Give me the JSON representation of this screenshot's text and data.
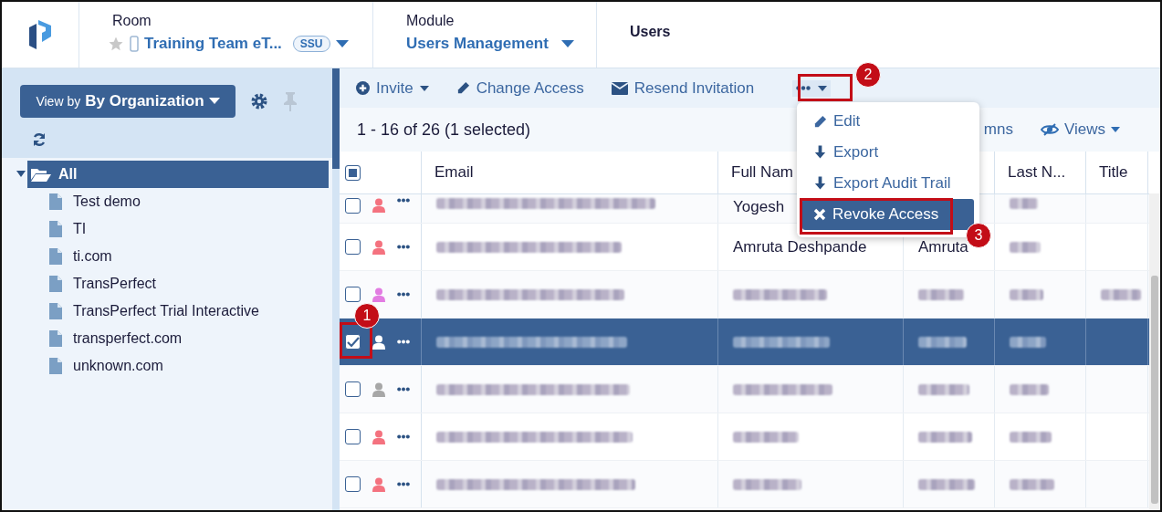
{
  "breadcrumb": {
    "room": {
      "label": "Room",
      "name": "Training Team eT...",
      "badge": "SSU",
      "starred": false
    },
    "module": {
      "label": "Module",
      "name": "Users Management"
    },
    "current": "Users"
  },
  "sidebar": {
    "view_by": {
      "label": "View by",
      "value": "By Organization"
    },
    "tree": [
      {
        "label": "All",
        "selected": true,
        "expanded": true,
        "children": [
          {
            "label": "Test demo",
            "selected": false
          },
          {
            "label": "TI",
            "selected": false
          },
          {
            "label": "ti.com",
            "selected": false
          },
          {
            "label": "TransPerfect",
            "selected": false
          },
          {
            "label": "TransPerfect Trial Interactive",
            "selected": false
          },
          {
            "label": "transperfect.com",
            "selected": false
          },
          {
            "label": "unknown.com",
            "selected": false
          }
        ]
      }
    ]
  },
  "toolbar": {
    "buttons": [
      {
        "label": "Invite",
        "kind": "invite"
      },
      {
        "label": "Change Access",
        "kind": "edit"
      },
      {
        "label": "Resend Invitation",
        "kind": "mail"
      }
    ],
    "more_open": true
  },
  "summary": "1 - 16 of 26 (1 selected)",
  "columns_button": "mns",
  "views_button": "Views",
  "more_menu": [
    {
      "label": "Edit",
      "kind": "edit",
      "selected": false
    },
    {
      "label": "Export",
      "kind": "download",
      "selected": false
    },
    {
      "label": "Export Audit Trail",
      "kind": "download",
      "selected": false
    },
    {
      "label": "Revoke Access",
      "kind": "revoke",
      "selected": true
    }
  ],
  "table": {
    "select_all_partial": true,
    "columns": [
      "Email",
      "Full Nam",
      "",
      "Last N...",
      "Title"
    ],
    "rows": [
      {
        "checked": false,
        "selected": false,
        "color": "#f4727f",
        "cells": [
          {
            "kind": "redacted"
          },
          {
            "kind": "text",
            "text": "Yogesh"
          },
          {
            "kind": "empty"
          },
          {
            "kind": "redacted"
          },
          {
            "kind": "empty"
          }
        ]
      },
      {
        "checked": false,
        "selected": false,
        "color": "#f4727f",
        "cells": [
          {
            "kind": "redacted"
          },
          {
            "kind": "text",
            "text": "Amruta Deshpande"
          },
          {
            "kind": "text",
            "text": "Amruta"
          },
          {
            "kind": "redacted"
          },
          {
            "kind": "empty"
          }
        ]
      },
      {
        "checked": false,
        "selected": false,
        "color": "#e27ce2",
        "cells": [
          {
            "kind": "redacted"
          },
          {
            "kind": "redacted"
          },
          {
            "kind": "redacted"
          },
          {
            "kind": "redacted"
          },
          {
            "kind": "redacted"
          }
        ]
      },
      {
        "checked": true,
        "selected": true,
        "color": "#ffffff",
        "cells": [
          {
            "kind": "redacted"
          },
          {
            "kind": "redacted"
          },
          {
            "kind": "redacted"
          },
          {
            "kind": "redacted"
          },
          {
            "kind": "empty"
          }
        ]
      },
      {
        "checked": false,
        "selected": false,
        "color": "#a7a7a7",
        "cells": [
          {
            "kind": "redacted"
          },
          {
            "kind": "redacted"
          },
          {
            "kind": "redacted"
          },
          {
            "kind": "redacted"
          },
          {
            "kind": "empty"
          }
        ]
      },
      {
        "checked": false,
        "selected": false,
        "color": "#f4727f",
        "cells": [
          {
            "kind": "redacted"
          },
          {
            "kind": "redacted"
          },
          {
            "kind": "redacted"
          },
          {
            "kind": "redacted"
          },
          {
            "kind": "empty"
          }
        ]
      },
      {
        "checked": false,
        "selected": false,
        "color": "#f4727f",
        "cells": [
          {
            "kind": "redacted"
          },
          {
            "kind": "redacted"
          },
          {
            "kind": "redacted"
          },
          {
            "kind": "redacted"
          },
          {
            "kind": "empty"
          }
        ]
      }
    ]
  },
  "callouts": [
    "1",
    "2",
    "3"
  ]
}
